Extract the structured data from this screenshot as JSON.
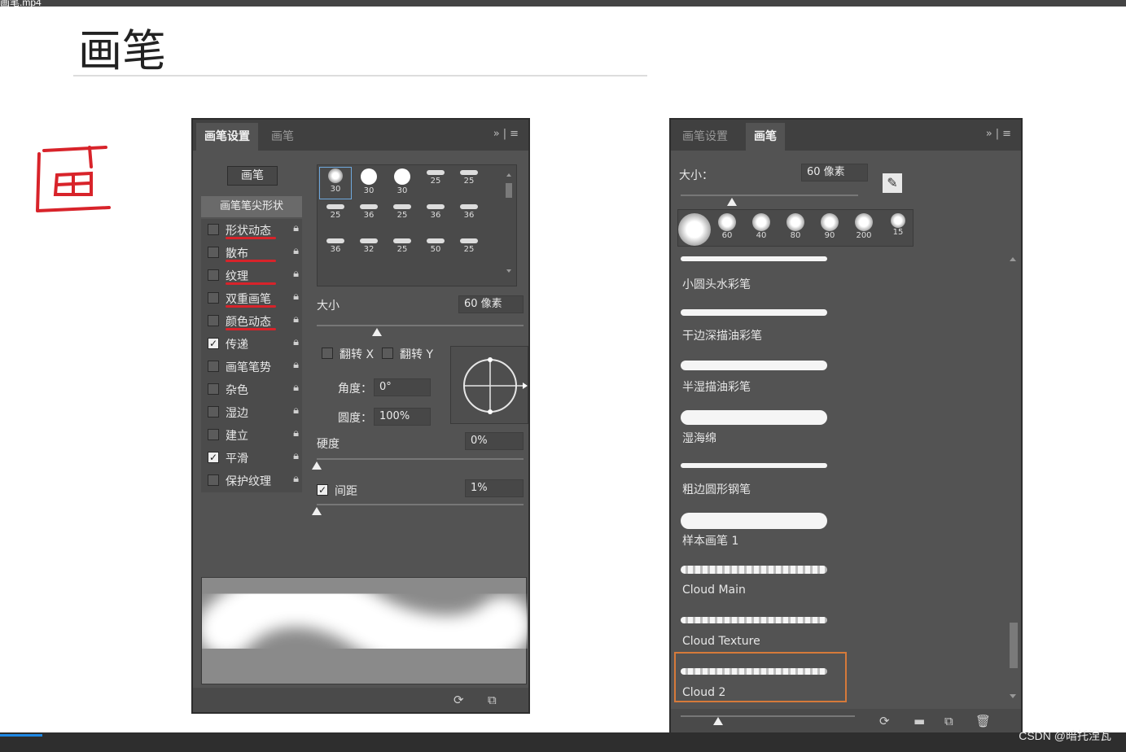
{
  "video": {
    "file_name_fragment": "画笔.mp4",
    "watermark": "CSDN @暗托涅瓦"
  },
  "slide": {
    "title": "画笔",
    "annotation_char": "画"
  },
  "left_panel": {
    "tabs": [
      "画笔设置",
      "画笔"
    ],
    "active_tab": 0,
    "preset_button": "画笔",
    "tip_shape_label": "画笔笔尖形状",
    "options": [
      {
        "label": "形状动态",
        "checked": false,
        "underlined": true
      },
      {
        "label": "散布",
        "checked": false,
        "underlined": true
      },
      {
        "label": "纹理",
        "checked": false,
        "underlined": true
      },
      {
        "label": "双重画笔",
        "checked": false,
        "underlined": true
      },
      {
        "label": "颜色动态",
        "checked": false,
        "underlined": true
      },
      {
        "label": "传递",
        "checked": true,
        "underlined": false
      },
      {
        "label": "画笔笔势",
        "checked": false,
        "underlined": false
      },
      {
        "label": "杂色",
        "checked": false,
        "underlined": false
      },
      {
        "label": "湿边",
        "checked": false,
        "underlined": false
      },
      {
        "label": "建立",
        "checked": false,
        "underlined": false
      },
      {
        "label": "平滑",
        "checked": true,
        "underlined": false
      },
      {
        "label": "保护纹理",
        "checked": false,
        "underlined": false
      }
    ],
    "tip_sizes": [
      [
        "30",
        "30",
        "30",
        "25",
        "25"
      ],
      [
        "25",
        "36",
        "25",
        "36",
        "36"
      ],
      [
        "36",
        "32",
        "25",
        "50",
        "25"
      ]
    ],
    "size_label": "大小",
    "size_value": "60 像素",
    "size_slider_fraction": 0.29,
    "flip_x_label": "翻转 X",
    "flip_y_label": "翻转 Y",
    "angle_label": "角度：",
    "angle_value": "0°",
    "roundness_label": "圆度：",
    "roundness_value": "100%",
    "hardness_label": "硬度",
    "hardness_value": "0%",
    "hardness_fraction": 0.0,
    "spacing_label": "间距",
    "spacing_checked": true,
    "spacing_value": "1%",
    "spacing_fraction": 0.0
  },
  "right_panel": {
    "tabs": [
      "画笔设置",
      "画笔"
    ],
    "active_tab": 1,
    "size_label": "大小：",
    "size_value": "60 像素",
    "size_slider_fraction": 0.29,
    "preset_sizes": [
      "",
      "60",
      "40",
      "80",
      "90",
      "200",
      "15"
    ],
    "brushes": [
      {
        "name": "小圆头水彩笔"
      },
      {
        "name": "干边深描油彩笔"
      },
      {
        "name": "半湿描油彩笔"
      },
      {
        "name": "湿海绵"
      },
      {
        "name": "粗边圆形钢笔"
      },
      {
        "name": "样本画笔 1"
      },
      {
        "name": "Cloud Main"
      },
      {
        "name": "Cloud Texture"
      },
      {
        "name": "Cloud 2"
      }
    ],
    "selected_brush": "Cloud 2"
  },
  "colors": {
    "panel_bg": "#535353",
    "tab_bg": "#404040",
    "selection": "#d67a3a",
    "annotation": "#d8232a",
    "progress": "#1e88e5"
  }
}
